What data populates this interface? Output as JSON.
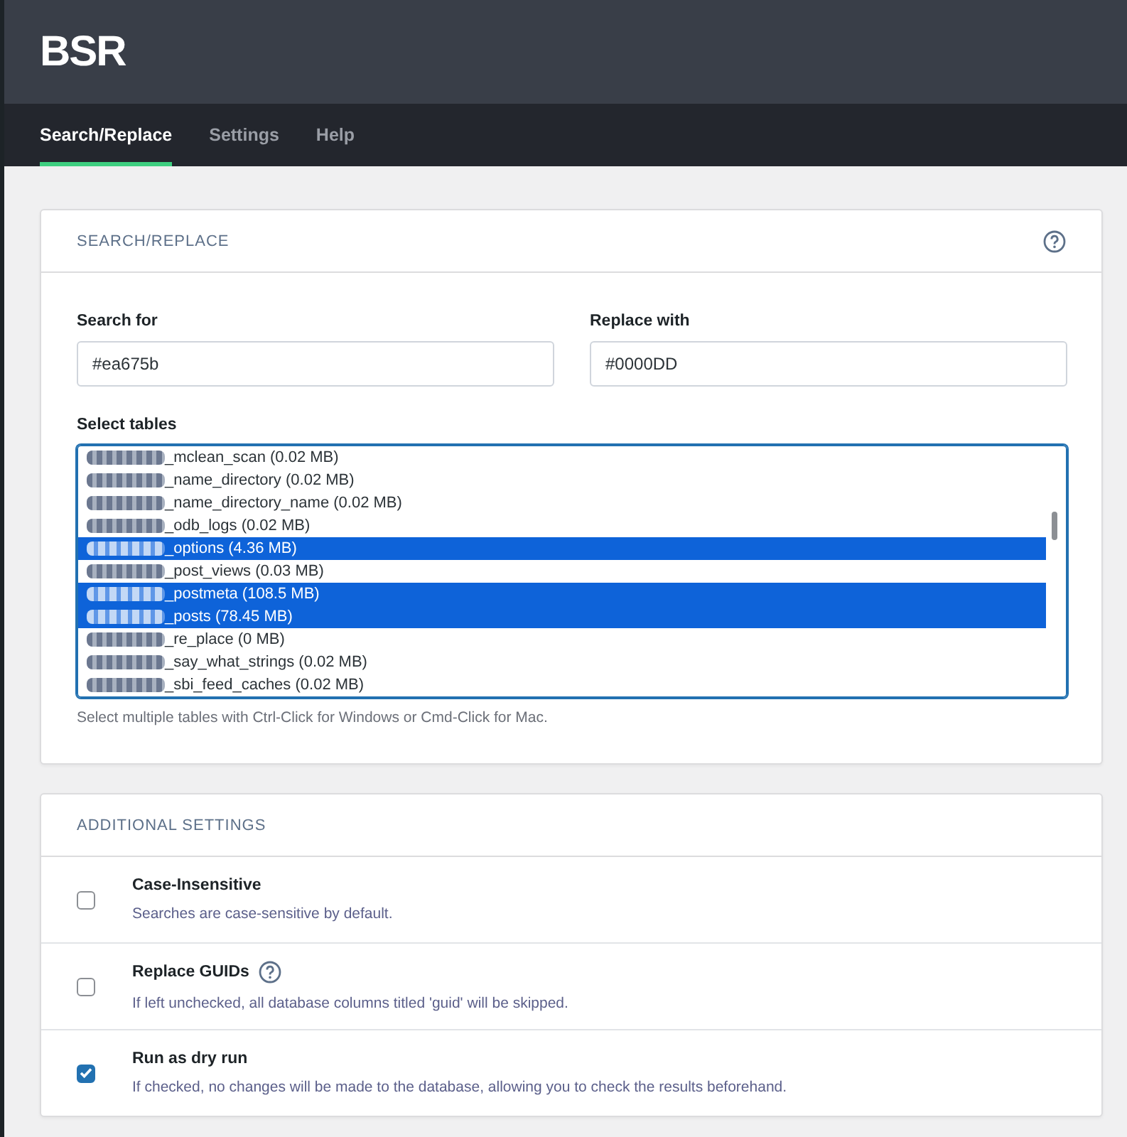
{
  "header": {
    "logo": "BSR"
  },
  "tabs": [
    {
      "label": "Search/Replace",
      "selected": true
    },
    {
      "label": "Settings",
      "selected": false
    },
    {
      "label": "Help",
      "selected": false
    }
  ],
  "search_replace": {
    "title": "SEARCH/REPLACE",
    "search": {
      "label": "Search for",
      "value": "#ea675b"
    },
    "replace": {
      "label": "Replace with",
      "value": "#0000DD"
    },
    "tables": {
      "label": "Select tables",
      "items": [
        {
          "name": "_mclean_scan (0.02 MB)",
          "selected": false
        },
        {
          "name": "_name_directory (0.02 MB)",
          "selected": false
        },
        {
          "name": "_name_directory_name (0.02 MB)",
          "selected": false
        },
        {
          "name": "_odb_logs (0.02 MB)",
          "selected": false
        },
        {
          "name": "_options (4.36 MB)",
          "selected": true
        },
        {
          "name": "_post_views (0.03 MB)",
          "selected": false
        },
        {
          "name": "_postmeta (108.5 MB)",
          "selected": true
        },
        {
          "name": "_posts (78.45 MB)",
          "selected": true
        },
        {
          "name": "_re_place (0 MB)",
          "selected": false
        },
        {
          "name": "_say_what_strings (0.02 MB)",
          "selected": false
        },
        {
          "name": "_sbi_feed_caches (0.02 MB)",
          "selected": false
        }
      ],
      "hint": "Select multiple tables with Ctrl-Click for Windows or Cmd-Click for Mac."
    }
  },
  "additional_settings": {
    "title": "ADDITIONAL SETTINGS",
    "options": [
      {
        "label": "Case-Insensitive",
        "description": "Searches are case-sensitive by default.",
        "checked": false,
        "help": false
      },
      {
        "label": "Replace GUIDs",
        "description": "If left unchecked, all database columns titled 'guid' will be skipped.",
        "checked": false,
        "help": true
      },
      {
        "label": "Run as dry run",
        "description": "If checked, no changes will be made to the database, allowing you to check the results beforehand.",
        "checked": true,
        "help": false
      }
    ]
  }
}
